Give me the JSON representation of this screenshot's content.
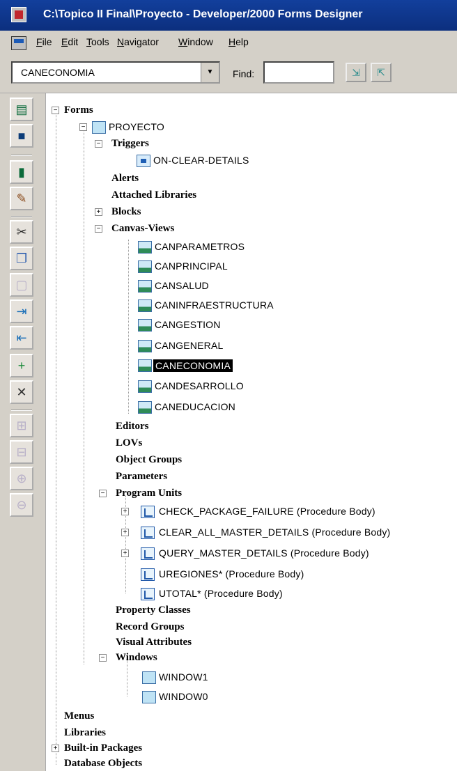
{
  "window": {
    "title": "C:\\Topico II Final\\Proyecto - Developer/2000 Forms Designer"
  },
  "menu": [
    "File",
    "Edit",
    "Tools",
    "Navigator",
    "Window",
    "Help"
  ],
  "toolbar": {
    "combo_value": "CANECONOMIA",
    "find_label": "Find:",
    "find_value": ""
  },
  "tree": {
    "forms": "Forms",
    "module": "PROYECTO",
    "triggers": "Triggers",
    "trigger_item": "ON-CLEAR-DETAILS",
    "alerts": "Alerts",
    "attached_libraries": "Attached Libraries",
    "blocks": "Blocks",
    "canvas_views": "Canvas-Views",
    "canvases": [
      "CANPARAMETROS",
      "CANPRINCIPAL",
      "CANSALUD",
      "CANINFRAESTRUCTURA",
      "CANGESTION",
      "CANGENERAL",
      "CANECONOMIA",
      "CANDESARROLLO",
      "CANEDUCACION"
    ],
    "selected_canvas": "CANECONOMIA",
    "editors": "Editors",
    "lovs": "LOVs",
    "object_groups": "Object Groups",
    "parameters": "Parameters",
    "program_units": "Program Units",
    "units": [
      "CHECK_PACKAGE_FAILURE (Procedure Body)",
      "CLEAR_ALL_MASTER_DETAILS (Procedure Body)",
      "QUERY_MASTER_DETAILS (Procedure Body)",
      "UREGIONES* (Procedure Body)",
      "UTOTAL* (Procedure Body)"
    ],
    "property_classes": "Property Classes",
    "record_groups": "Record Groups",
    "visual_attributes": "Visual Attributes",
    "windows": "Windows",
    "window_items": [
      "WINDOW1",
      "WINDOW0"
    ],
    "menus": "Menus",
    "libraries": "Libraries",
    "builtin_packages": "Built-in Packages",
    "database_objects": "Database Objects"
  },
  "icons": [
    "open-icon",
    "save-icon",
    "run-icon",
    "debug-icon",
    "cut-icon",
    "copy-icon",
    "paste-icon",
    "expand-icon",
    "collapse-icon",
    "create-icon",
    "delete-icon",
    "expand-all-icon",
    "collapse-all-icon",
    "find-next-icon",
    "find-prev-icon"
  ]
}
